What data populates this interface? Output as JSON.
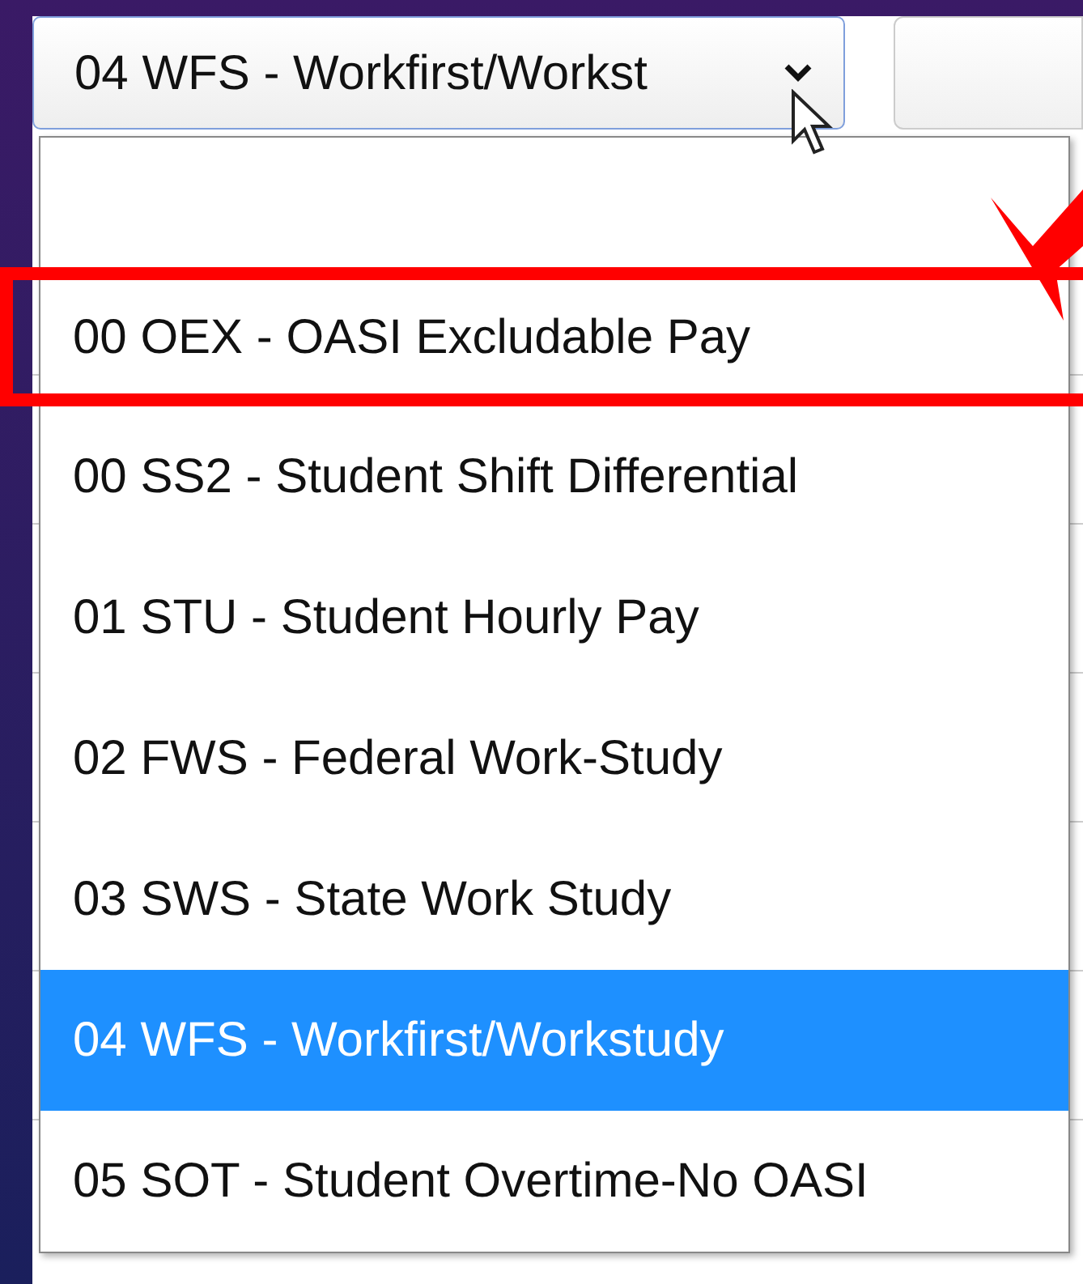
{
  "select": {
    "value": "04 WFS - Workfirst/Workst",
    "expanded": true
  },
  "options": [
    {
      "kind": "blank",
      "selected": false
    },
    {
      "kind": "option",
      "label": "00 OEX - OASI Excludable Pay",
      "selected": false
    },
    {
      "kind": "option",
      "label": "00 SS2 - Student Shift Differential",
      "selected": false
    },
    {
      "kind": "option",
      "label": "01 STU - Student Hourly Pay",
      "selected": false
    },
    {
      "kind": "option",
      "label": "02 FWS - Federal Work-Study",
      "selected": false
    },
    {
      "kind": "option",
      "label": "03 SWS - State Work Study",
      "selected": false
    },
    {
      "kind": "option",
      "label": "04 WFS - Workfirst/Workstudy",
      "selected": true
    },
    {
      "kind": "option",
      "label": "05 SOT - Student Overtime-No OASI",
      "selected": false
    }
  ]
}
